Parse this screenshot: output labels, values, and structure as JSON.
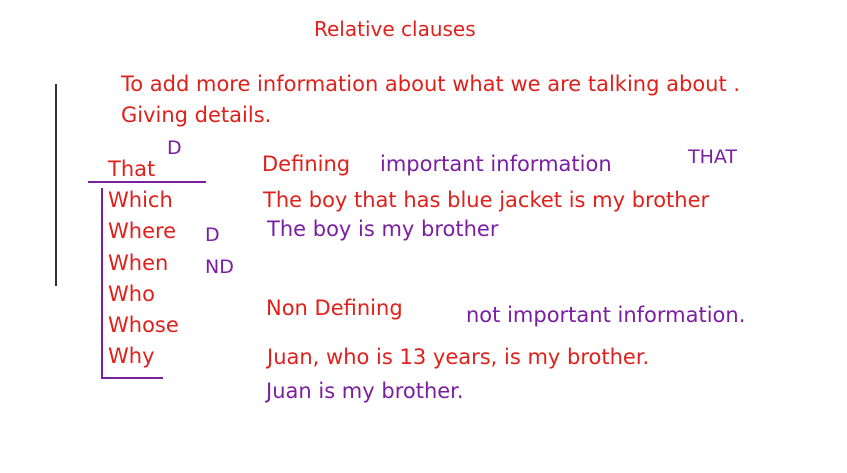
{
  "title": "Relative clauses",
  "intro": {
    "line1": "To add more information about what we are talking about .",
    "line2": "Giving details."
  },
  "pronouns": {
    "that": "That",
    "items": [
      "Which",
      "Where",
      "When",
      "Who",
      "Whose",
      "Why"
    ]
  },
  "annotations": {
    "d_above_that": "D",
    "d_marker": "D",
    "nd_marker": "ND",
    "that_caps": "THAT"
  },
  "defining": {
    "label": "Defining",
    "note": "important information",
    "example": "The boy that has blue jacket is my brother",
    "reduced": "The boy is my brother"
  },
  "non_defining": {
    "label": "Non Defining",
    "note": "not important information.",
    "example": "Juan, who is 13 years, is my brother.",
    "reduced": "Juan is my brother."
  },
  "colors": {
    "red_ink": "#e0201b",
    "purple_ink": "#7a1fa2",
    "dark_ink": "#333333"
  }
}
